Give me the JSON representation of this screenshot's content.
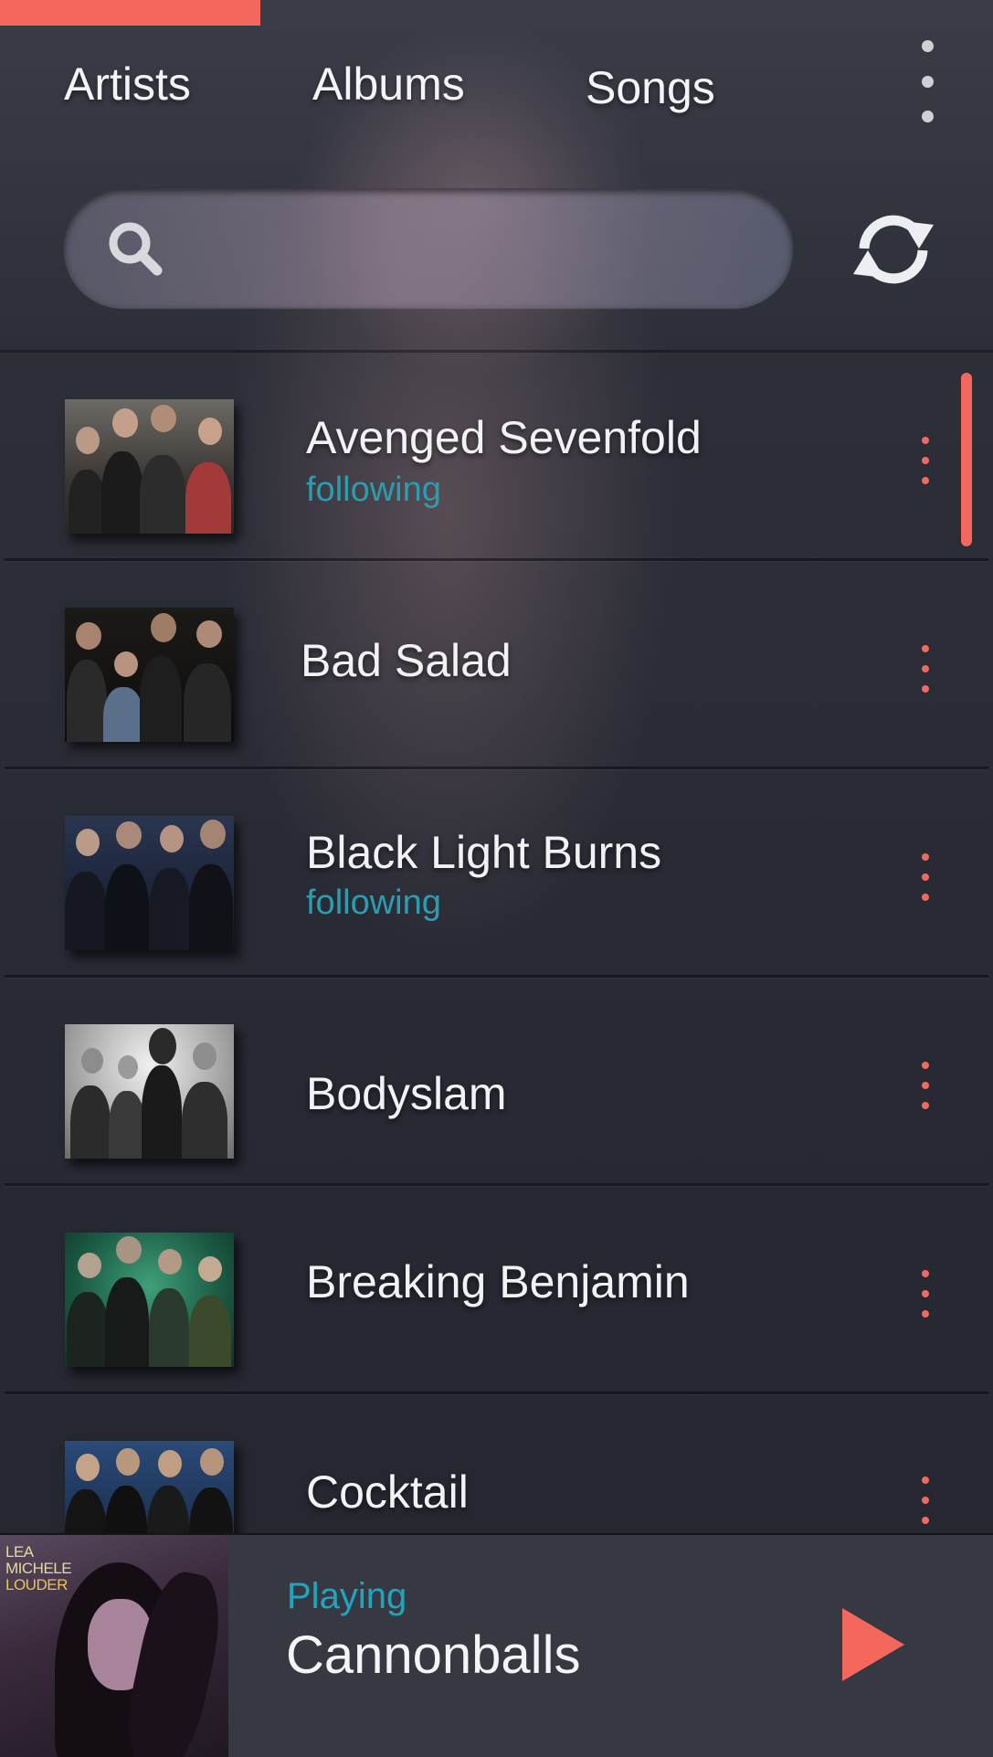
{
  "tabs": [
    {
      "label": "Artists"
    },
    {
      "label": "Albums"
    },
    {
      "label": "Songs"
    }
  ],
  "active_tab": "Artists",
  "icons": {
    "overflow": "more-vertical-icon",
    "search": "search-icon",
    "refresh": "sync-icon",
    "row_menu": "more-vertical-icon",
    "play": "play-icon"
  },
  "colors": {
    "accent": "#f4675c",
    "following": "#2a9eb0",
    "playing": "#1fa5c0",
    "background": "#2a2c36"
  },
  "artists": [
    {
      "name": "Avenged Sevenfold",
      "status": "following"
    },
    {
      "name": "Bad Salad",
      "status": ""
    },
    {
      "name": "Black Light Burns",
      "status": "following"
    },
    {
      "name": "Bodyslam",
      "status": ""
    },
    {
      "name": "Breaking Benjamin",
      "status": ""
    },
    {
      "name": "Cocktail",
      "status": ""
    }
  ],
  "now_playing": {
    "status": "Playing",
    "title": "Cannonballs",
    "album_art_text": [
      "LEA",
      "MICHELE",
      "LOUDER"
    ]
  }
}
